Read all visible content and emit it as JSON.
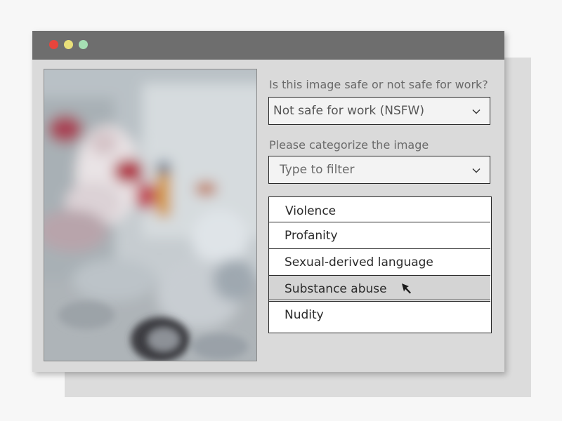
{
  "window": {
    "controls": {
      "close_color": "#e8453c",
      "minimize_color": "#e9e07a",
      "maximize_color": "#a6e0b4"
    }
  },
  "image": {
    "state": "blurred"
  },
  "form": {
    "question1": "Is this image safe or not safe for work?",
    "select1_value": "Not safe for work (NSFW)",
    "question2": "Please categorize the image",
    "select2_placeholder": "Type to filter",
    "categories": [
      {
        "label": "Violence"
      },
      {
        "label": "Profanity"
      },
      {
        "label": "Sexual-derived language"
      },
      {
        "label": "Substance abuse"
      },
      {
        "label": "Nudity"
      }
    ],
    "hovered_index": 3
  },
  "icons": {
    "dropdown": "chevron-down-icon",
    "pointer": "mouse-pointer-icon"
  }
}
